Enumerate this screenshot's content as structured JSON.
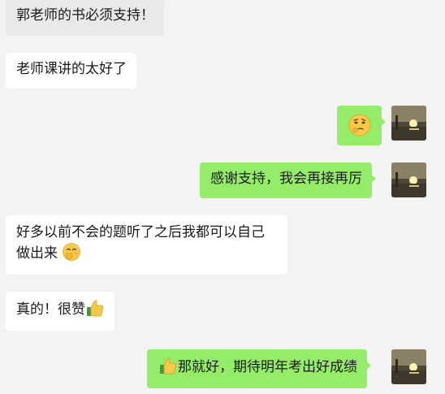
{
  "messages": [
    {
      "side": "in",
      "text": "郭老师的书必须支持！"
    },
    {
      "side": "in",
      "text": "老师课讲的太好了"
    },
    {
      "side": "out",
      "emoji": "thinking-face-icon"
    },
    {
      "side": "out",
      "text": "感谢支持，我会再接再厉"
    },
    {
      "side": "in",
      "text_line1": "好多以前不会的题听了之后我都可以自己",
      "text_line2": "做出来",
      "emoji": "face-with-hand-over-mouth-icon"
    },
    {
      "side": "in",
      "text": "真的！很赞",
      "emoji": "thumbs-up-icon"
    },
    {
      "side": "out",
      "text": "那就好，期待明年考出好成绩",
      "emoji": "thumbs-up-icon"
    }
  ],
  "colors": {
    "background": "#f3f3f3",
    "incoming_bubble": "#ffffff",
    "outgoing_bubble": "#95ec69",
    "text": "#1a1a1a"
  }
}
